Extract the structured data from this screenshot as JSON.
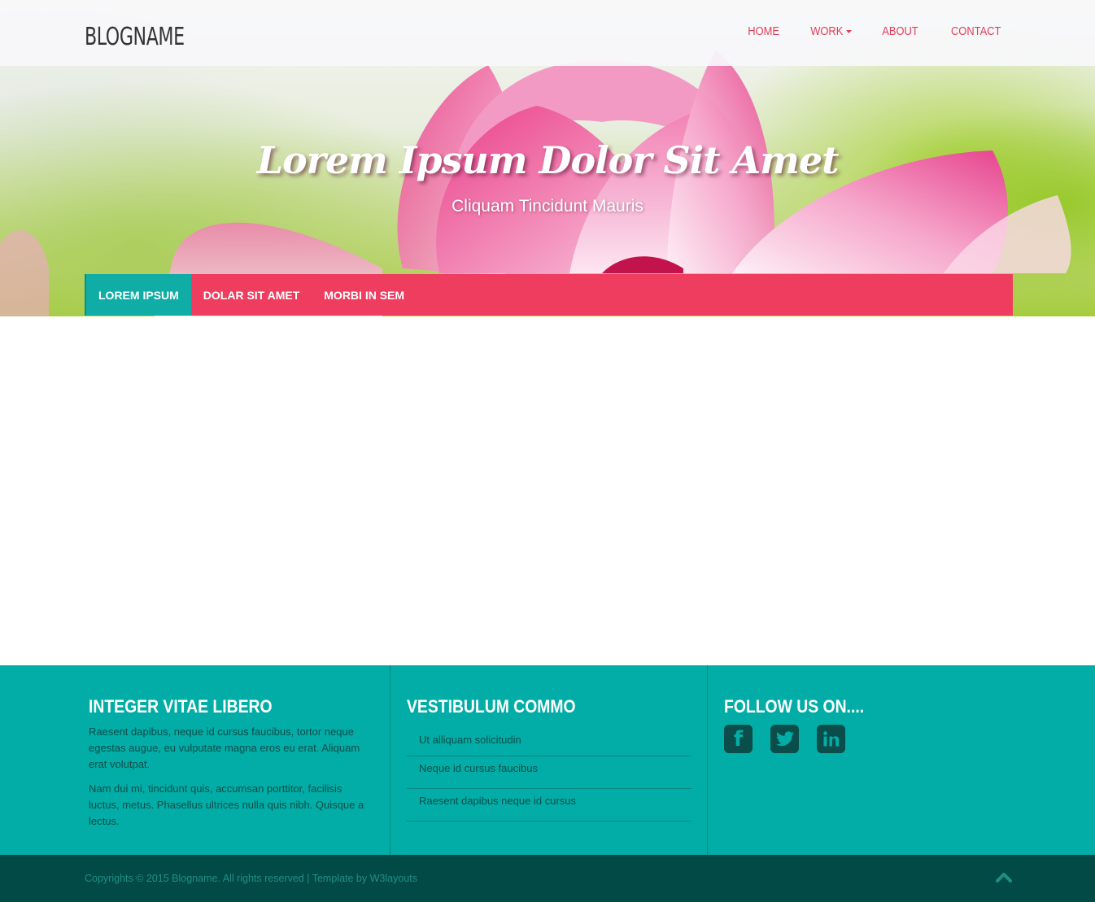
{
  "header": {
    "brand": "BLOGNAME",
    "nav": [
      {
        "label": "HOME"
      },
      {
        "label": "WORK",
        "has_caret": true
      },
      {
        "label": "ABOUT"
      },
      {
        "label": "CONTACT"
      }
    ]
  },
  "hero": {
    "title": "Lorem Ipsum Dolor Sit Amet",
    "subtitle": "Cliquam Tincidunt Mauris"
  },
  "subnav": {
    "items": [
      {
        "label": "LOREM IPSUM",
        "active": true
      },
      {
        "label": "DOLAR SIT AMET"
      },
      {
        "label": "MORBI IN SEM"
      }
    ]
  },
  "footer": {
    "col1": {
      "heading": "INTEGER VITAE LIBERO",
      "para1": "Raesent dapibus, neque id cursus faucibus, tortor neque egestas augue, eu vulputate magna eros eu erat. Aliquam erat volutpat.",
      "para2": "Nam dui mi, tincidunt quis, accumsan porttitor, facilisis luctus, metus. Phasellus ultrices nulla quis nibh. Quisque a lectus."
    },
    "col2": {
      "heading": "VESTIBULUM COMMO",
      "links": [
        "Ut alliquam solicitudin",
        "Neque id cursus faucibus",
        "Raesent dapibus neque id cursus"
      ]
    },
    "col3": {
      "heading": "FOLLOW US ON....",
      "icons": [
        "facebook-icon",
        "twitter-icon",
        "linkedin-icon"
      ]
    },
    "copyright": "Copyrights © 2015 Blogname. All rights reserved | Template by W3layouts"
  },
  "colors": {
    "accent_pink": "#ee3d5f",
    "nav_text": "#e23e58",
    "teal": "#01ada6",
    "dark_teal": "#024a45"
  }
}
